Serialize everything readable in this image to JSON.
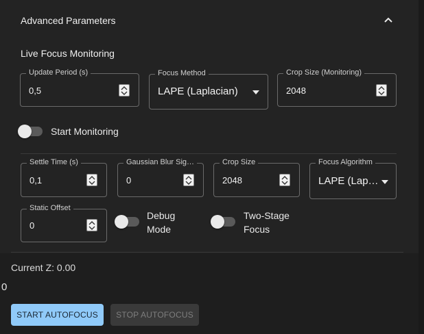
{
  "header": {
    "title": "Advanced Parameters"
  },
  "live_focus": {
    "title": "Live Focus Monitoring",
    "update_period": {
      "label": "Update Period (s)",
      "value": "0,5"
    },
    "focus_method": {
      "label": "Focus Method",
      "value": "LAPE (Laplacian)"
    },
    "crop_size": {
      "label": "Crop Size (Monitoring)",
      "value": "2048"
    },
    "start_monitoring": {
      "label": "Start Monitoring",
      "checked": false
    }
  },
  "autofocus_params": {
    "settle_time": {
      "label": "Settle Time (s)",
      "value": "0,1"
    },
    "gaussian_blur": {
      "label": "Gaussian Blur Sig…",
      "value": "0"
    },
    "crop_size": {
      "label": "Crop Size",
      "value": "2048"
    },
    "focus_algorithm": {
      "label": "Focus Algorithm",
      "value": "LAPE (Lap…"
    },
    "static_offset": {
      "label": "Static Offset",
      "value": "0"
    },
    "debug_mode": {
      "label_line1": "Debug",
      "label_line2": "Mode",
      "checked": false
    },
    "two_stage": {
      "label_line1": "Two-Stage",
      "label_line2": "Focus",
      "checked": false
    }
  },
  "status": {
    "current_z": "Current Z: 0.00",
    "counter": "0"
  },
  "actions": {
    "start_label": "START AUTOFOCUS",
    "stop_label": "STOP AUTOFOCUS"
  },
  "colors": {
    "primary": "#90caf9",
    "background": "#232323",
    "outline": "#6b6b6b"
  }
}
